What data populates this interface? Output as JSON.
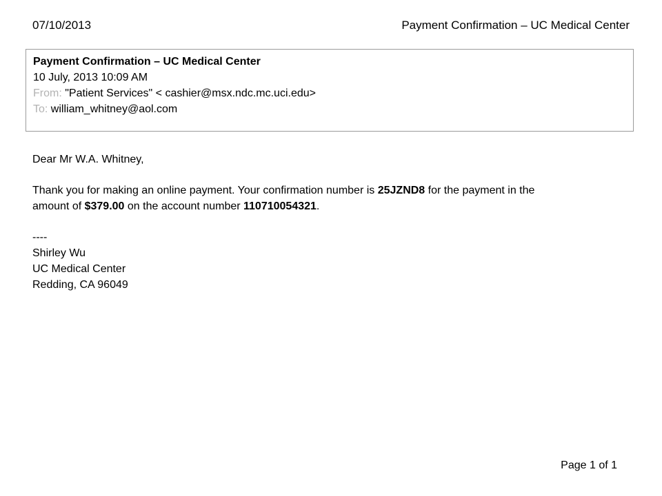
{
  "page_header": {
    "date": "07/10/2013",
    "title": "Payment Confirmation – UC Medical Center"
  },
  "email": {
    "subject": "Payment Confirmation – UC Medical Center",
    "datetime": "10 July, 2013 10:09 AM",
    "from_label": "From:",
    "from_value": "\"Patient Services\" < cashier@msx.ndc.mc.uci.edu>",
    "to_label": "To:",
    "to_value": "william_whitney@aol.com"
  },
  "body": {
    "greeting": "Dear Mr W.A. Whitney,",
    "para_part1": "Thank you for making an online payment. Your confirmation number is ",
    "confirmation_number": "25JZND8",
    "para_part2": " for the payment in the",
    "para_part3": "amount of ",
    "amount": "$379.00",
    "para_part4": " on the account number ",
    "account_number": "110710054321",
    "para_part5": ".",
    "separator": "----",
    "signature_name": "Shirley Wu",
    "signature_org": "UC Medical Center",
    "signature_address": "Redding, CA 96049"
  },
  "footer": {
    "page_label": "Page 1 of 1"
  }
}
